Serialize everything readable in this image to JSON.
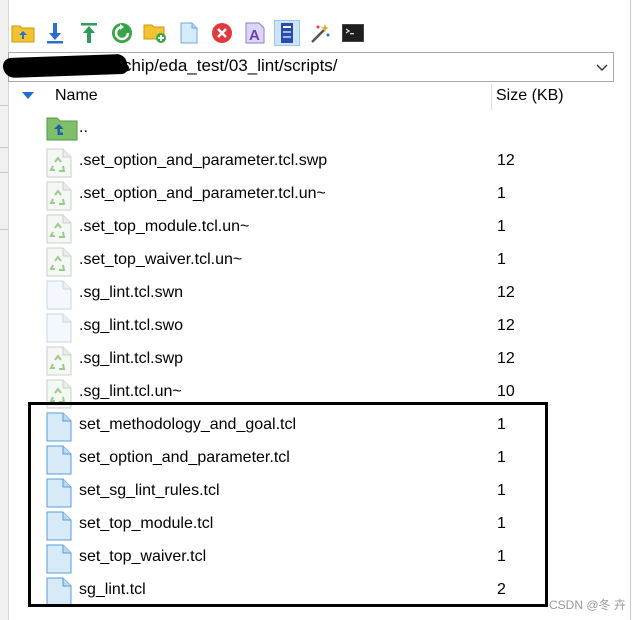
{
  "toolbar": {
    "buttons": [
      {
        "name": "parent-folder-button",
        "icon": "folder-up-icon"
      },
      {
        "name": "download-button",
        "icon": "download-icon"
      },
      {
        "name": "upload-button",
        "icon": "upload-icon"
      },
      {
        "name": "refresh-button",
        "icon": "refresh-icon"
      },
      {
        "name": "new-folder-button",
        "icon": "new-folder-icon"
      },
      {
        "name": "new-file-button",
        "icon": "new-file-icon"
      },
      {
        "name": "delete-button",
        "icon": "delete-icon"
      },
      {
        "name": "rename-button",
        "icon": "rename-icon"
      },
      {
        "name": "properties-button",
        "icon": "properties-icon"
      },
      {
        "name": "new-link-button",
        "icon": "magic-wand-icon"
      },
      {
        "name": "terminal-button",
        "icon": "terminal-icon"
      }
    ]
  },
  "path": {
    "value": "chip/eda_test/03_lint/scripts/"
  },
  "columns": {
    "name": "Name",
    "size": "Size (KB)"
  },
  "files": [
    {
      "name": "..",
      "size": "",
      "kind": "parent"
    },
    {
      "name": ".set_option_and_parameter.tcl.swp",
      "size": "12",
      "kind": "hidden"
    },
    {
      "name": ".set_option_and_parameter.tcl.un~",
      "size": "1",
      "kind": "hidden"
    },
    {
      "name": ".set_top_module.tcl.un~",
      "size": "1",
      "kind": "hidden"
    },
    {
      "name": ".set_top_waiver.tcl.un~",
      "size": "1",
      "kind": "hidden"
    },
    {
      "name": ".sg_lint.tcl.swn",
      "size": "12",
      "kind": "plain"
    },
    {
      "name": ".sg_lint.tcl.swo",
      "size": "12",
      "kind": "plain"
    },
    {
      "name": ".sg_lint.tcl.swp",
      "size": "12",
      "kind": "hidden"
    },
    {
      "name": ".sg_lint.tcl.un~",
      "size": "10",
      "kind": "hidden"
    },
    {
      "name": "set_methodology_and_goal.tcl",
      "size": "1",
      "kind": "tcl"
    },
    {
      "name": "set_option_and_parameter.tcl",
      "size": "1",
      "kind": "tcl"
    },
    {
      "name": "set_sg_lint_rules.tcl",
      "size": "1",
      "kind": "tcl"
    },
    {
      "name": "set_top_module.tcl",
      "size": "1",
      "kind": "tcl"
    },
    {
      "name": "set_top_waiver.tcl",
      "size": "1",
      "kind": "tcl"
    },
    {
      "name": "sg_lint.tcl",
      "size": "2",
      "kind": "tcl"
    }
  ],
  "watermark": "CSDN @冬 卉",
  "colors": {
    "accent": "#1c6fd1",
    "selected_button": "#cce4f7",
    "folder_green": "#7fbf6a",
    "file_blue": "#d6eaf8"
  }
}
